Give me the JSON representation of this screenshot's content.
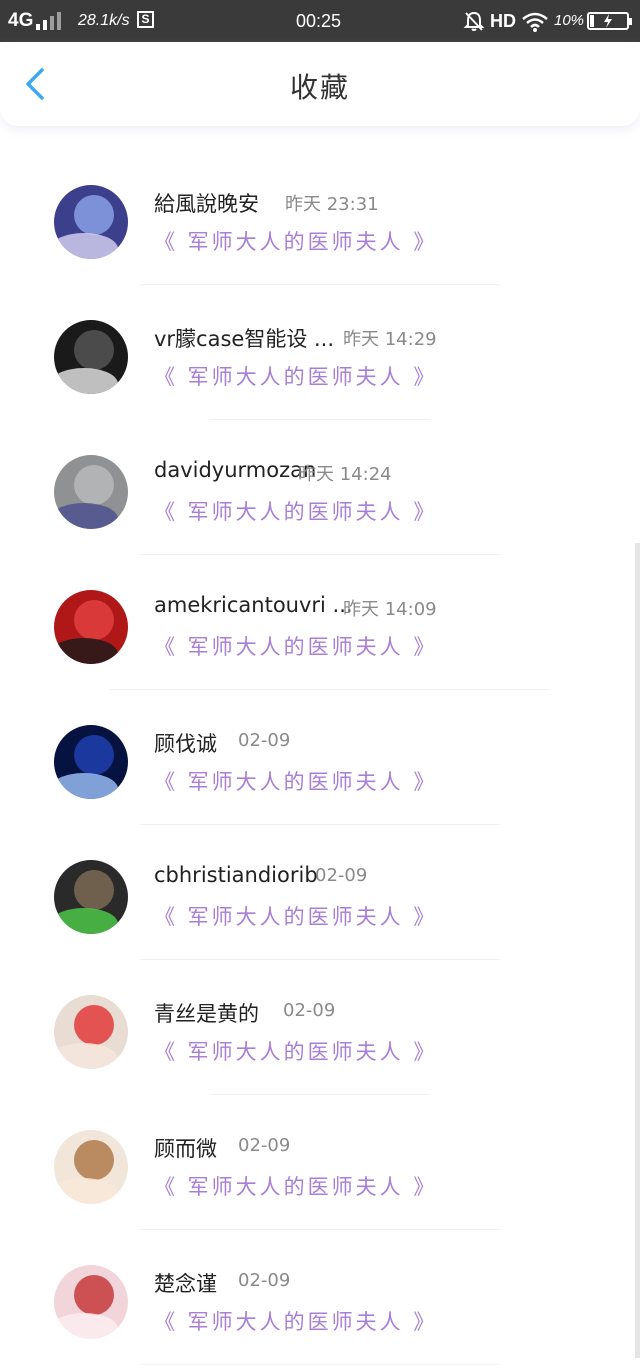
{
  "status_bar": {
    "network": "4G",
    "speed": "28.1k/s",
    "s_badge": "S",
    "clock": "00:25",
    "hd": "HD",
    "battery_percent_text": "10%",
    "battery_level": 0.1,
    "icons": [
      "signal-icon",
      "mute-alarm-icon",
      "wifi-icon",
      "battery-charging-icon"
    ]
  },
  "nav": {
    "title": "收藏",
    "back_icon": "chevron-left-icon",
    "accent_color": "#3da8f5"
  },
  "colors": {
    "book_title": "#a97fd6",
    "time": "#8a8a8a",
    "name": "#222222"
  },
  "items": [
    {
      "name": "給風說晚安",
      "time": "昨天 23:31",
      "book": "《 军师大人的医师夫人 》"
    },
    {
      "name": "vr朦case智能设 ...",
      "time": "昨天 14:29",
      "book": "《 军师大人的医师夫人 》"
    },
    {
      "name": "davidyurmozan",
      "time": "昨天 14:24",
      "book": "《 军师大人的医师夫人 》"
    },
    {
      "name": "amekricantouvri ...",
      "time": "昨天 14:09",
      "book": "《 军师大人的医师夫人 》"
    },
    {
      "name": "顾伐诚",
      "time": "02-09",
      "book": "《 军师大人的医师夫人 》"
    },
    {
      "name": "cbhristiandiorib",
      "time": "02-09",
      "book": "《 军师大人的医师夫人 》"
    },
    {
      "name": "青丝是黄的",
      "time": "02-09",
      "book": "《 军师大人的医师夫人 》"
    },
    {
      "name": "顾而微",
      "time": "02-09",
      "book": "《 军师大人的医师夫人 》"
    },
    {
      "name": "楚念谨",
      "time": "02-09",
      "book": "《 军师大人的医师夫人 》"
    }
  ]
}
